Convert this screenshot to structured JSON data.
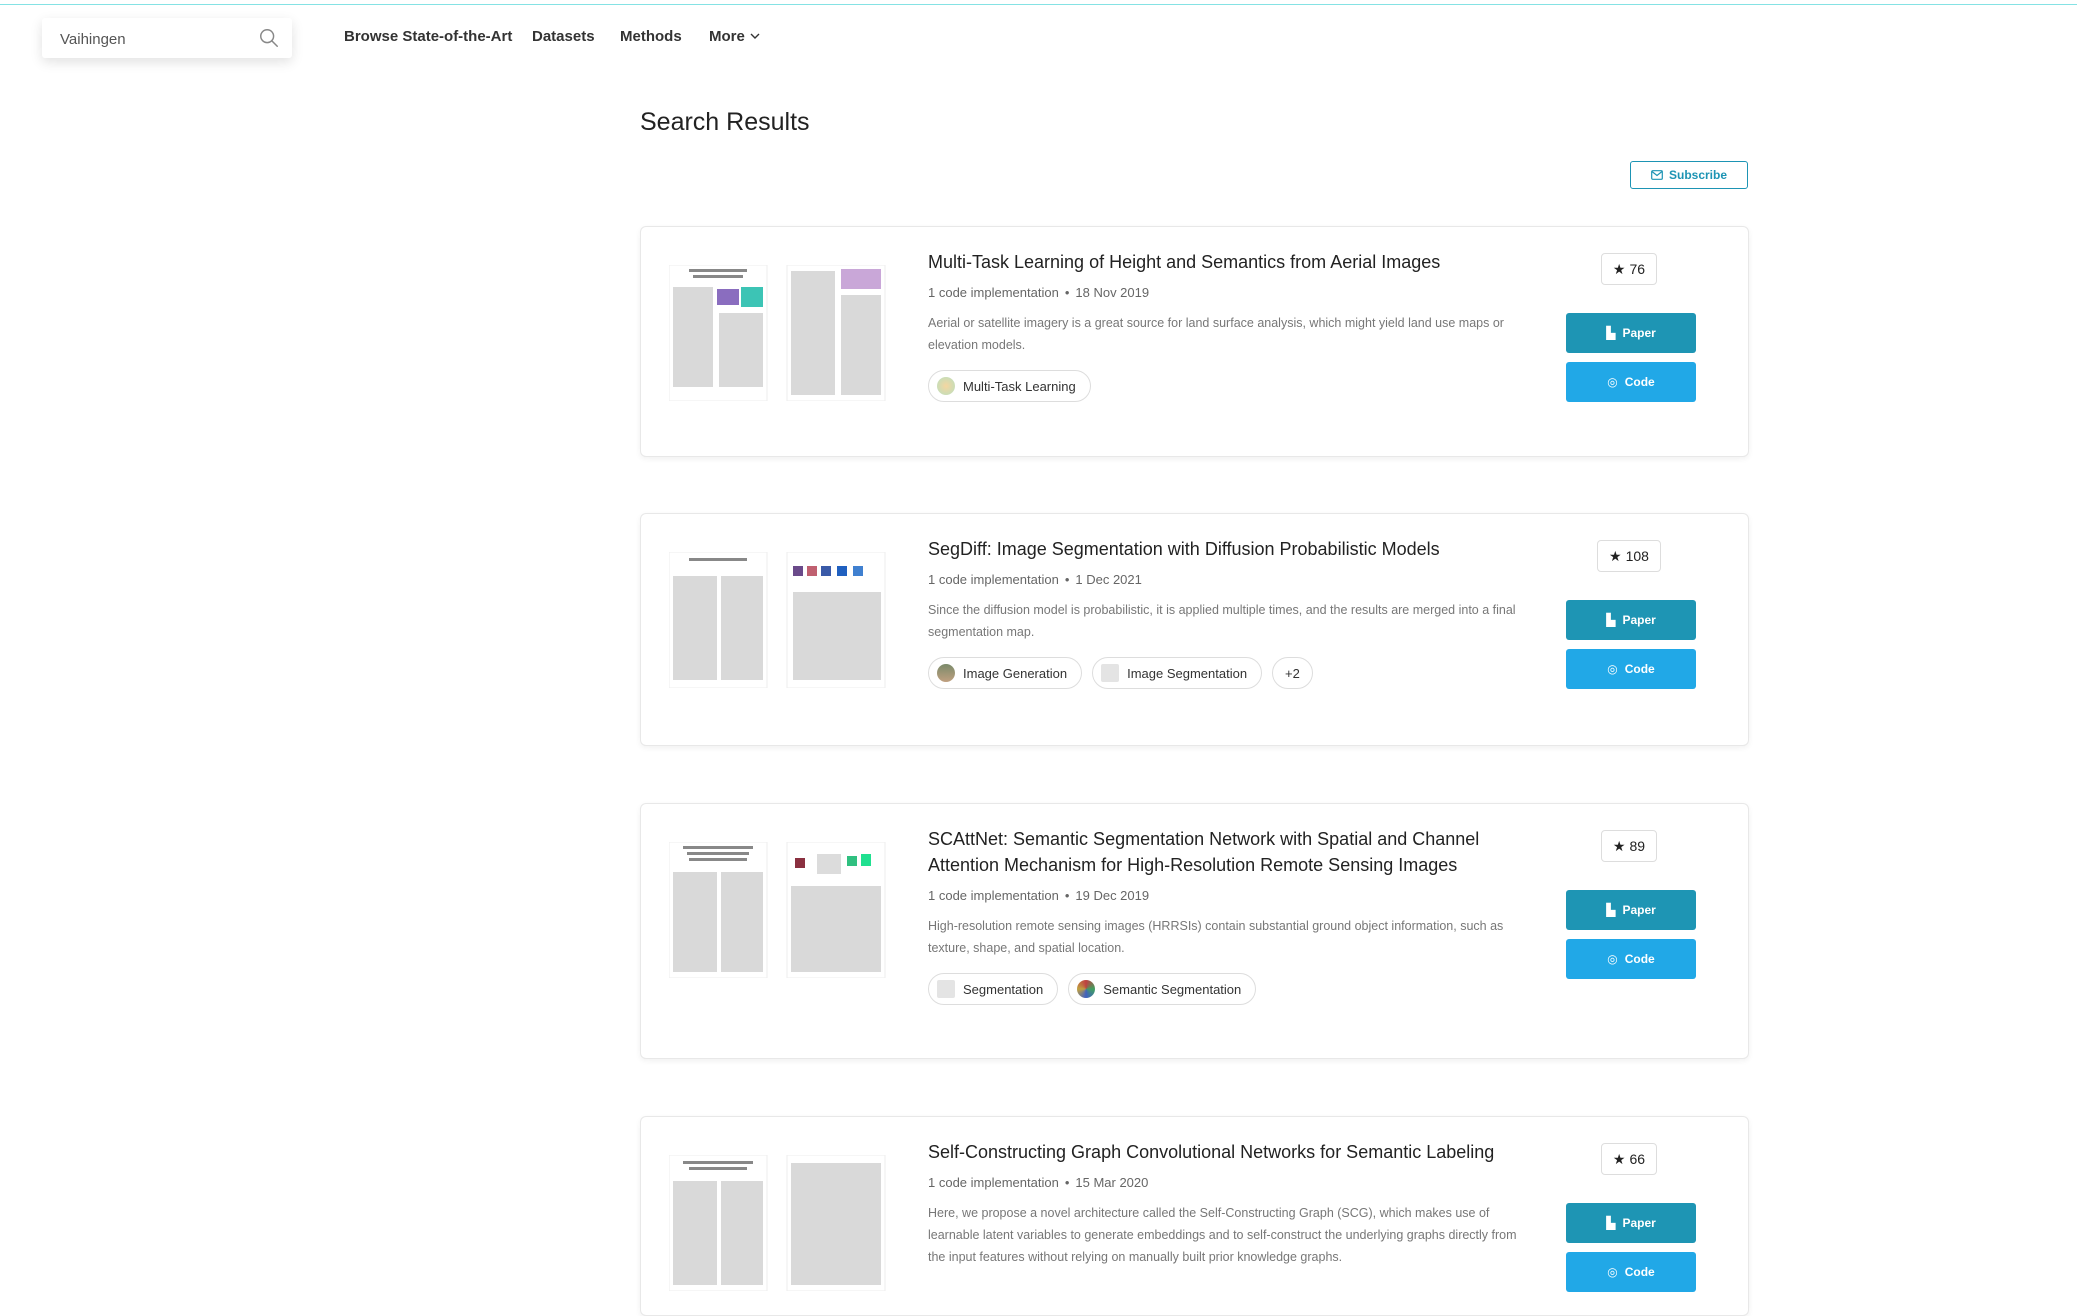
{
  "search": {
    "value": "Vaihingen"
  },
  "nav": {
    "browse": "Browse State-of-the-Art",
    "datasets": "Datasets",
    "methods": "Methods",
    "more": "More"
  },
  "page_title": "Search Results",
  "subscribe_label": "Subscribe",
  "colors": {
    "accent": "#1e95b4",
    "code_button": "#21a8e7",
    "topline": "#21cbce"
  },
  "results": [
    {
      "title": "Multi-Task Learning of Height and Semantics from Aerial Images",
      "implementations": "1 code implementation",
      "date": "18 Nov 2019",
      "abstract": "Aerial or satellite imagery is a great source for land surface analysis, which might yield land use maps or elevation models.",
      "stars": "76",
      "paper_label": "Paper",
      "code_label": "Code",
      "tags": [
        "Multi-Task Learning"
      ]
    },
    {
      "title": "SegDiff: Image Segmentation with Diffusion Probabilistic Models",
      "implementations": "1 code implementation",
      "date": "1 Dec 2021",
      "abstract": "Since the diffusion model is probabilistic, it is applied multiple times, and the results are merged into a final segmentation map.",
      "stars": "108",
      "paper_label": "Paper",
      "code_label": "Code",
      "tags": [
        "Image Generation",
        "Image Segmentation"
      ],
      "more_tags": "+2"
    },
    {
      "title": "SCAttNet: Semantic Segmentation Network with Spatial and Channel Attention Mechanism for High-Resolution Remote Sensing Images",
      "implementations": "1 code implementation",
      "date": "19 Dec 2019",
      "abstract": "High-resolution remote sensing images (HRRSIs) contain substantial ground object information, such as texture, shape, and spatial location.",
      "stars": "89",
      "paper_label": "Paper",
      "code_label": "Code",
      "tags": [
        "Segmentation",
        "Semantic Segmentation"
      ]
    },
    {
      "title": "Self-Constructing Graph Convolutional Networks for Semantic Labeling",
      "implementations": "1 code implementation",
      "date": "15 Mar 2020",
      "abstract": "Here, we propose a novel architecture called the Self-Constructing Graph (SCG), which makes use of learnable latent variables to generate embeddings and to self-construct the underlying graphs directly from the input features without relying on manually built prior knowledge graphs.",
      "stars": "66",
      "paper_label": "Paper",
      "code_label": "Code",
      "tags": []
    }
  ]
}
